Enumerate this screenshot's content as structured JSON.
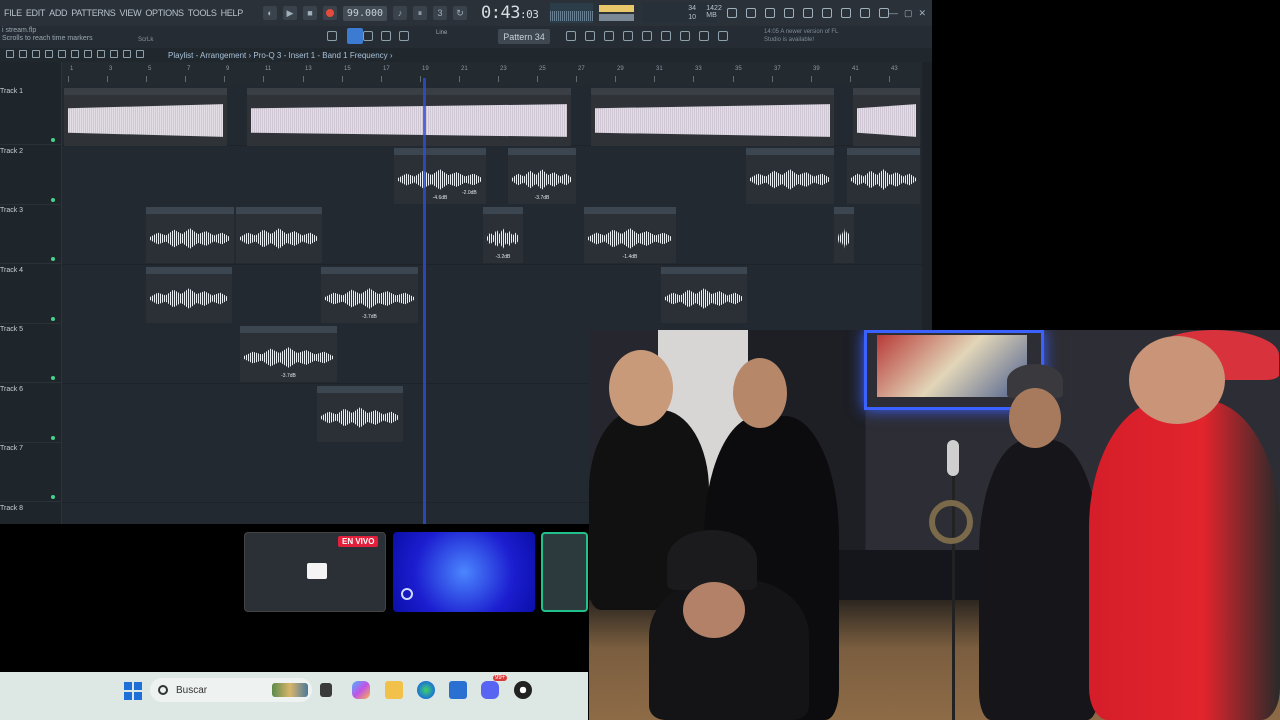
{
  "menus": [
    "FILE",
    "EDIT",
    "ADD",
    "PATTERNS",
    "VIEW",
    "OPTIONS",
    "TOOLS",
    "HELP"
  ],
  "transport": {
    "tempo": "99.000",
    "time_main": "0:43",
    "time_sub": ":03",
    "cpu_left": "34",
    "ram": "1422 MB",
    "cpu_right": "10"
  },
  "toolbar": {
    "hint_file": "i stream.flp",
    "hint_text": "Scrolls to reach time markers",
    "scroll_label": "ScrLk",
    "snap_label": "Line",
    "pattern_label": "Pattern 34",
    "news_time": "14:05",
    "news_text": "A newer version of FL Studio is available!"
  },
  "playlist": {
    "breadcrumb": "Playlist - Arrangement › Pro-Q 3 - Insert 1 - Band 1 Frequency ›",
    "ruler": [
      "1",
      "3",
      "5",
      "7",
      "9",
      "11",
      "13",
      "15",
      "17",
      "19",
      "21",
      "23",
      "25",
      "27",
      "29",
      "31",
      "33",
      "35",
      "37",
      "39",
      "41",
      "43"
    ],
    "tracks": [
      "Track 1",
      "Track 2",
      "Track 3",
      "Track 4",
      "Track 5",
      "Track 6",
      "Track 7",
      "Track 8"
    ]
  },
  "clips": {
    "baet": "baet 99 f minorr",
    "t2a": "stream_...Insert 5",
    "t2b": "str..rt 5",
    "t2c": "strea..ert 5",
    "t2d": "stream_2026_..26_Insert",
    "t2e": "stream_20.._Insert",
    "t3a": "stream_2026_..24_Insert 5",
    "t3b": "stream_2026_..22_Insert 5",
    "t3c": "strea..ert 5",
    "t3d": "stream_2026_..-51_Insert 5",
    "t3e": "s..5",
    "t4a": "stream_2026_26_Insert 5",
    "t4b": "stream_2026_0..7-54_Insert 5",
    "t4c": "stream_2026_..-22_Insert 5",
    "t5a": "stream_2026_0..7-54_Insert 5",
    "t6a": "stream_2026_..22_Insert 5",
    "gain_t2a": "-4.6dB",
    "gain_t2b": "-2.0dB",
    "gain_t2c": "-3.7dB",
    "gain_t3c": "-3.2dB",
    "gain_t3d": "-1.4dB",
    "gain_t4b": "-3.7dB",
    "gain_t5a": "-3.7dB"
  },
  "desktop": {
    "live_badge": "EN VIVO",
    "search_placeholder": "Buscar",
    "discord_badge": "99+"
  },
  "colors": {
    "accent": "#3b7bd1",
    "playhead": "#2d4fd6",
    "live": "#e3203b",
    "track_dot": "#44d38e"
  }
}
